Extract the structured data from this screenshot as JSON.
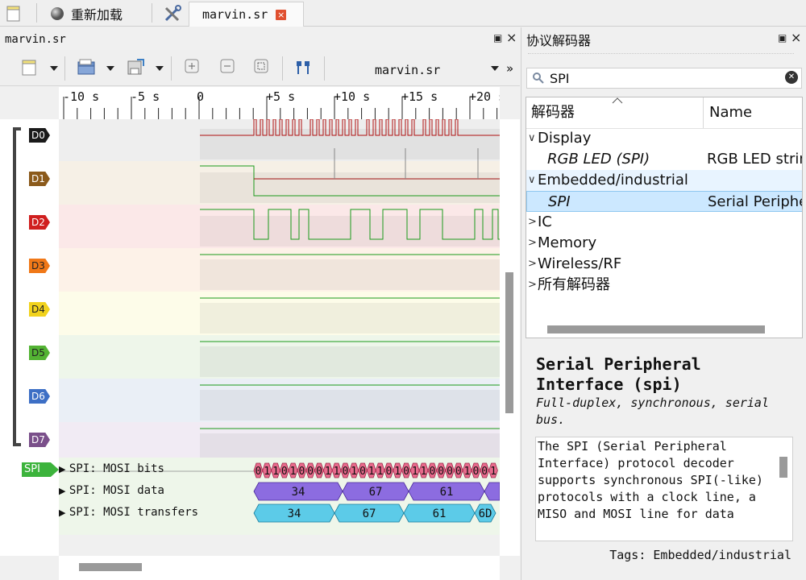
{
  "topbar": {
    "reload_label": "重新加载",
    "file_tab_label": "marvin.sr",
    "file_tab_close": "×"
  },
  "left_dock": {
    "title": "marvin.sr",
    "float_glyph": "▣",
    "close_glyph": "×",
    "toolbar": {
      "session_name": "marvin.sr",
      "overflow_glyph": "»",
      "icons": [
        "new-session-icon",
        "open-file-icon",
        "save-icon",
        "zoom-in-icon",
        "zoom-out-icon",
        "zoom-fit-icon",
        "cursor-icon"
      ]
    },
    "ruler": {
      "ticks": [
        {
          "label": "-10 s",
          "t": -10
        },
        {
          "label": "-5 s",
          "t": -5
        },
        {
          "label": "0",
          "t": 0
        },
        {
          "label": "+5 s",
          "t": 5
        },
        {
          "label": "+10 s",
          "t": 10
        },
        {
          "label": "+15 s",
          "t": 15
        },
        {
          "label": "+20 s",
          "t": 20
        }
      ]
    },
    "channels": [
      {
        "name": "D0",
        "color": "#1a1a1a",
        "text_color": "#ffffff",
        "band": "#eeeeee"
      },
      {
        "name": "D1",
        "color": "#8b5a1b",
        "text_color": "#ffffff",
        "band": "#f6f0e6"
      },
      {
        "name": "D2",
        "color": "#d01f1f",
        "text_color": "#ffffff",
        "band": "#fbe8e8"
      },
      {
        "name": "D3",
        "color": "#f07818",
        "text_color": "#222222",
        "band": "#fdf2e8"
      },
      {
        "name": "D4",
        "color": "#f1d21c",
        "text_color": "#222222",
        "band": "#fdfce9"
      },
      {
        "name": "D5",
        "color": "#53b333",
        "text_color": "#222222",
        "band": "#eef6ea"
      },
      {
        "name": "D6",
        "color": "#3d6fc5",
        "text_color": "#ffffff",
        "band": "#eaeff6"
      },
      {
        "name": "D7",
        "color": "#7a4f8a",
        "text_color": "#ffffff",
        "band": "#f1ebf4"
      }
    ],
    "decoder": {
      "tag": "SPI",
      "tag_color": "#3cb33c",
      "rows": [
        {
          "label": "SPI: MOSI bits",
          "bits": "0110100011010110101100001001"
        },
        {
          "label": "SPI: MOSI data",
          "values": [
            "34",
            "67",
            "61"
          ]
        },
        {
          "label": "SPI: MOSI transfers",
          "values": [
            "34",
            "67",
            "61",
            "6D"
          ]
        }
      ]
    }
  },
  "right_dock": {
    "title": "协议解码器",
    "float_glyph": "▣",
    "close_glyph": "×",
    "search": {
      "value": "SPI",
      "clear_glyph": "✕"
    },
    "tree": {
      "col_id": "解码器",
      "col_name": "Name",
      "rows": [
        {
          "label": "Display",
          "level": 0,
          "expanded": true
        },
        {
          "label": "RGB LED (SPI)",
          "name": "RGB LED strin.",
          "level": 1
        },
        {
          "label": "Embedded/industrial",
          "level": 0,
          "expanded": true
        },
        {
          "label": "SPI",
          "name": "Serial Periphe",
          "level": 1,
          "selected": true
        },
        {
          "label": "IC",
          "level": 0,
          "expanded": false
        },
        {
          "label": "Memory",
          "level": 0,
          "expanded": false
        },
        {
          "label": "Wireless/RF",
          "level": 0,
          "expanded": false
        },
        {
          "label": "所有解码器",
          "level": 0,
          "expanded": false
        }
      ]
    },
    "description": {
      "title": "Serial Peripheral Interface (spi)",
      "subtitle": "Full-duplex, synchronous, serial bus.",
      "body": "The SPI (Serial Peripheral Interface) protocol decoder supports synchronous SPI(-like) protocols with a clock line, a MISO and MOSI line for data",
      "tags": "Tags: Embedded/industrial"
    }
  }
}
